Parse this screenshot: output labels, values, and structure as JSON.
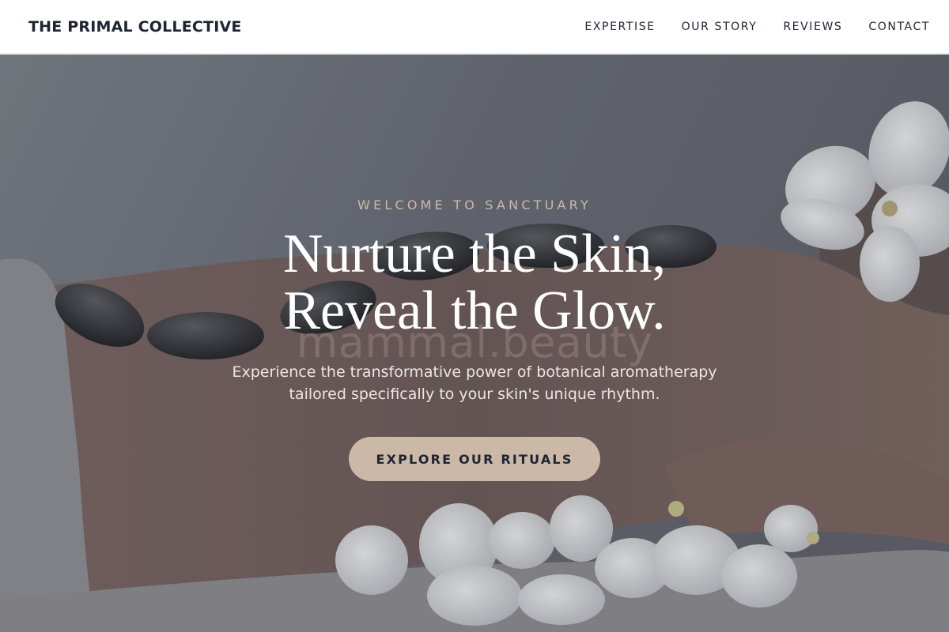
{
  "header": {
    "logo": "THE PRIMAL COLLECTIVE",
    "nav": [
      {
        "label": "EXPERTISE"
      },
      {
        "label": "OUR STORY"
      },
      {
        "label": "REVIEWS"
      },
      {
        "label": "CONTACT"
      }
    ]
  },
  "hero": {
    "eyebrow": "WELCOME TO SANCTUARY",
    "headline": [
      "Nurture the Skin,",
      "Reveal the Glow."
    ],
    "watermark": "mammal.beauty",
    "subhead": [
      "Experience the transformative power of botanical aromatherapy",
      "tailored specifically to your skin's unique rhythm."
    ],
    "cta_label": "EXPLORE OUR RITUALS",
    "background_image": "spa-massage-hot-stones-orchids"
  },
  "colors": {
    "brand_dark": "#1d2433",
    "accent": "#ccb8a6",
    "eyebrow": "#cdb9a8"
  }
}
